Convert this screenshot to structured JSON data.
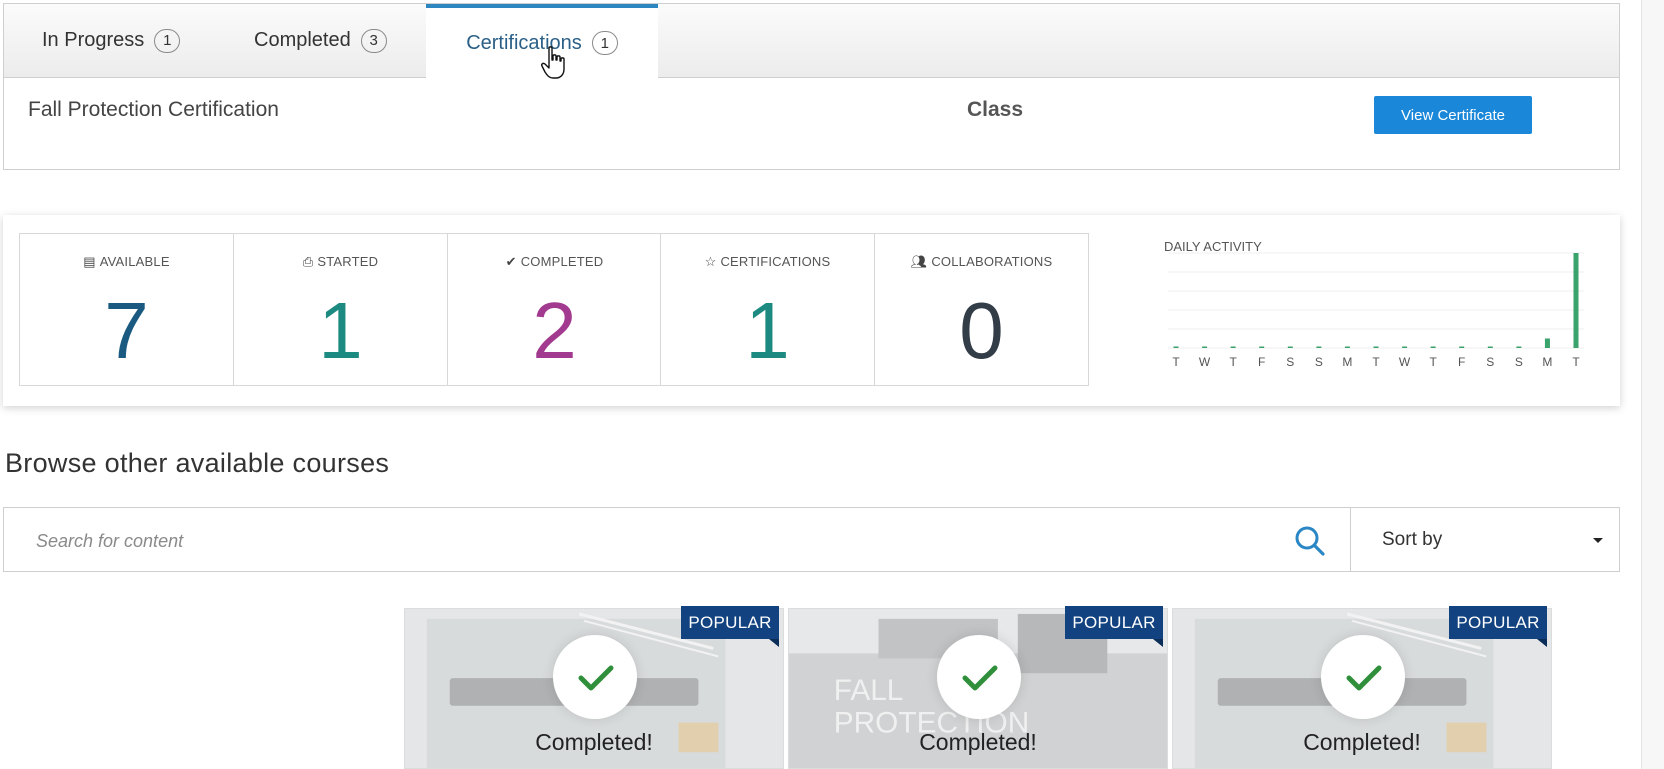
{
  "tabs": [
    {
      "label": "In Progress",
      "count": "1"
    },
    {
      "label": "Completed",
      "count": "3"
    },
    {
      "label": "Certifications",
      "count": "1"
    }
  ],
  "certification": {
    "name": "Fall Protection Certification",
    "type": "Class",
    "button_label": "View Certificate"
  },
  "stats": [
    {
      "label": "AVAILABLE",
      "value": "7",
      "icon": "catalog-icon",
      "color": "#1b5a80"
    },
    {
      "label": "STARTED",
      "value": "1",
      "icon": "inbox-icon",
      "color": "#1c8a80"
    },
    {
      "label": "COMPLETED",
      "value": "2",
      "icon": "check-icon",
      "color": "#a23a8f"
    },
    {
      "label": "CERTIFICATIONS",
      "value": "1",
      "icon": "star-icon",
      "color": "#1c8a80"
    },
    {
      "label": "COLLABORATIONS",
      "value": "0",
      "icon": "users-icon",
      "color": "#333d47"
    }
  ],
  "daily_activity": {
    "title": "DAILY ACTIVITY",
    "bar_color": "#3aa26b",
    "chart_data": {
      "type": "bar",
      "categories": [
        "T",
        "W",
        "T",
        "F",
        "S",
        "S",
        "M",
        "T",
        "W",
        "T",
        "F",
        "S",
        "S",
        "M",
        "T"
      ],
      "values": [
        0,
        0,
        0,
        0,
        0,
        0,
        0,
        0,
        0,
        0,
        0,
        0,
        0,
        1,
        10
      ],
      "ylim": [
        0,
        10
      ],
      "grid": true
    }
  },
  "browse": {
    "title": "Browse other available courses",
    "search_placeholder": "Search for content",
    "sort_label": "Sort by"
  },
  "courses": [
    {
      "badge": "POPULAR",
      "status": "Completed!"
    },
    {
      "badge": "POPULAR",
      "status": "Completed!",
      "image_text": "FALL PROTECTION"
    },
    {
      "badge": "POPULAR",
      "status": "Completed!"
    }
  ]
}
